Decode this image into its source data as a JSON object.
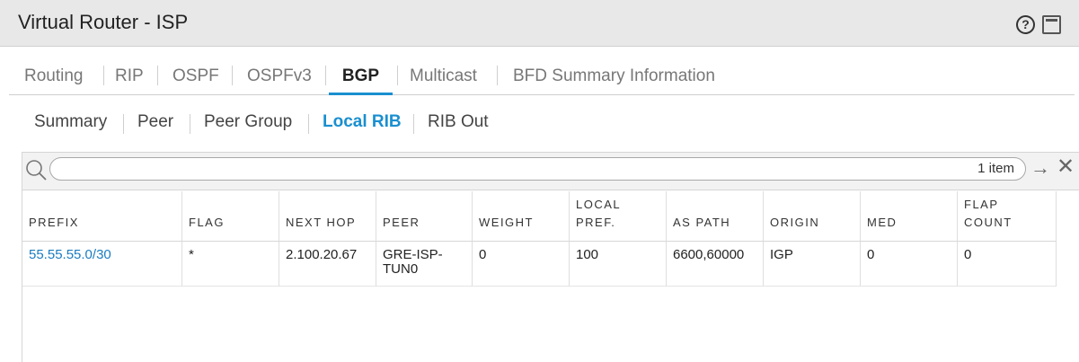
{
  "window": {
    "title": "Virtual Router - ISP",
    "help_icon": "help-icon",
    "window_icon": "window-icon"
  },
  "main_tabs": [
    {
      "label": "Routing",
      "active": false
    },
    {
      "label": "RIP",
      "active": false
    },
    {
      "label": "OSPF",
      "active": false
    },
    {
      "label": "OSPFv3",
      "active": false
    },
    {
      "label": "BGP",
      "active": true
    },
    {
      "label": "Multicast",
      "active": false
    },
    {
      "label": "BFD Summary Information",
      "active": false
    }
  ],
  "sub_tabs": [
    {
      "label": "Summary",
      "active": false
    },
    {
      "label": "Peer",
      "active": false
    },
    {
      "label": "Peer Group",
      "active": false
    },
    {
      "label": "Local RIB",
      "active": true
    },
    {
      "label": "RIB Out",
      "active": false
    }
  ],
  "search": {
    "value": "",
    "placeholder": "",
    "count_text": "1 item"
  },
  "colors": {
    "accent": "#1a8fd0",
    "link": "#1a7cc2",
    "title_bg": "#e8e8e8"
  },
  "table": {
    "columns": [
      "PREFIX",
      "FLAG",
      "NEXT HOP",
      "PEER",
      "WEIGHT",
      "LOCAL PREF.",
      "AS PATH",
      "ORIGIN",
      "MED",
      "FLAP COUNT"
    ],
    "rows": [
      [
        "55.55.55.0/30",
        "*",
        "2.100.20.67",
        "GRE-ISP-TUN0",
        "0",
        "100",
        "6600,60000",
        "IGP",
        "0",
        "0"
      ]
    ]
  }
}
